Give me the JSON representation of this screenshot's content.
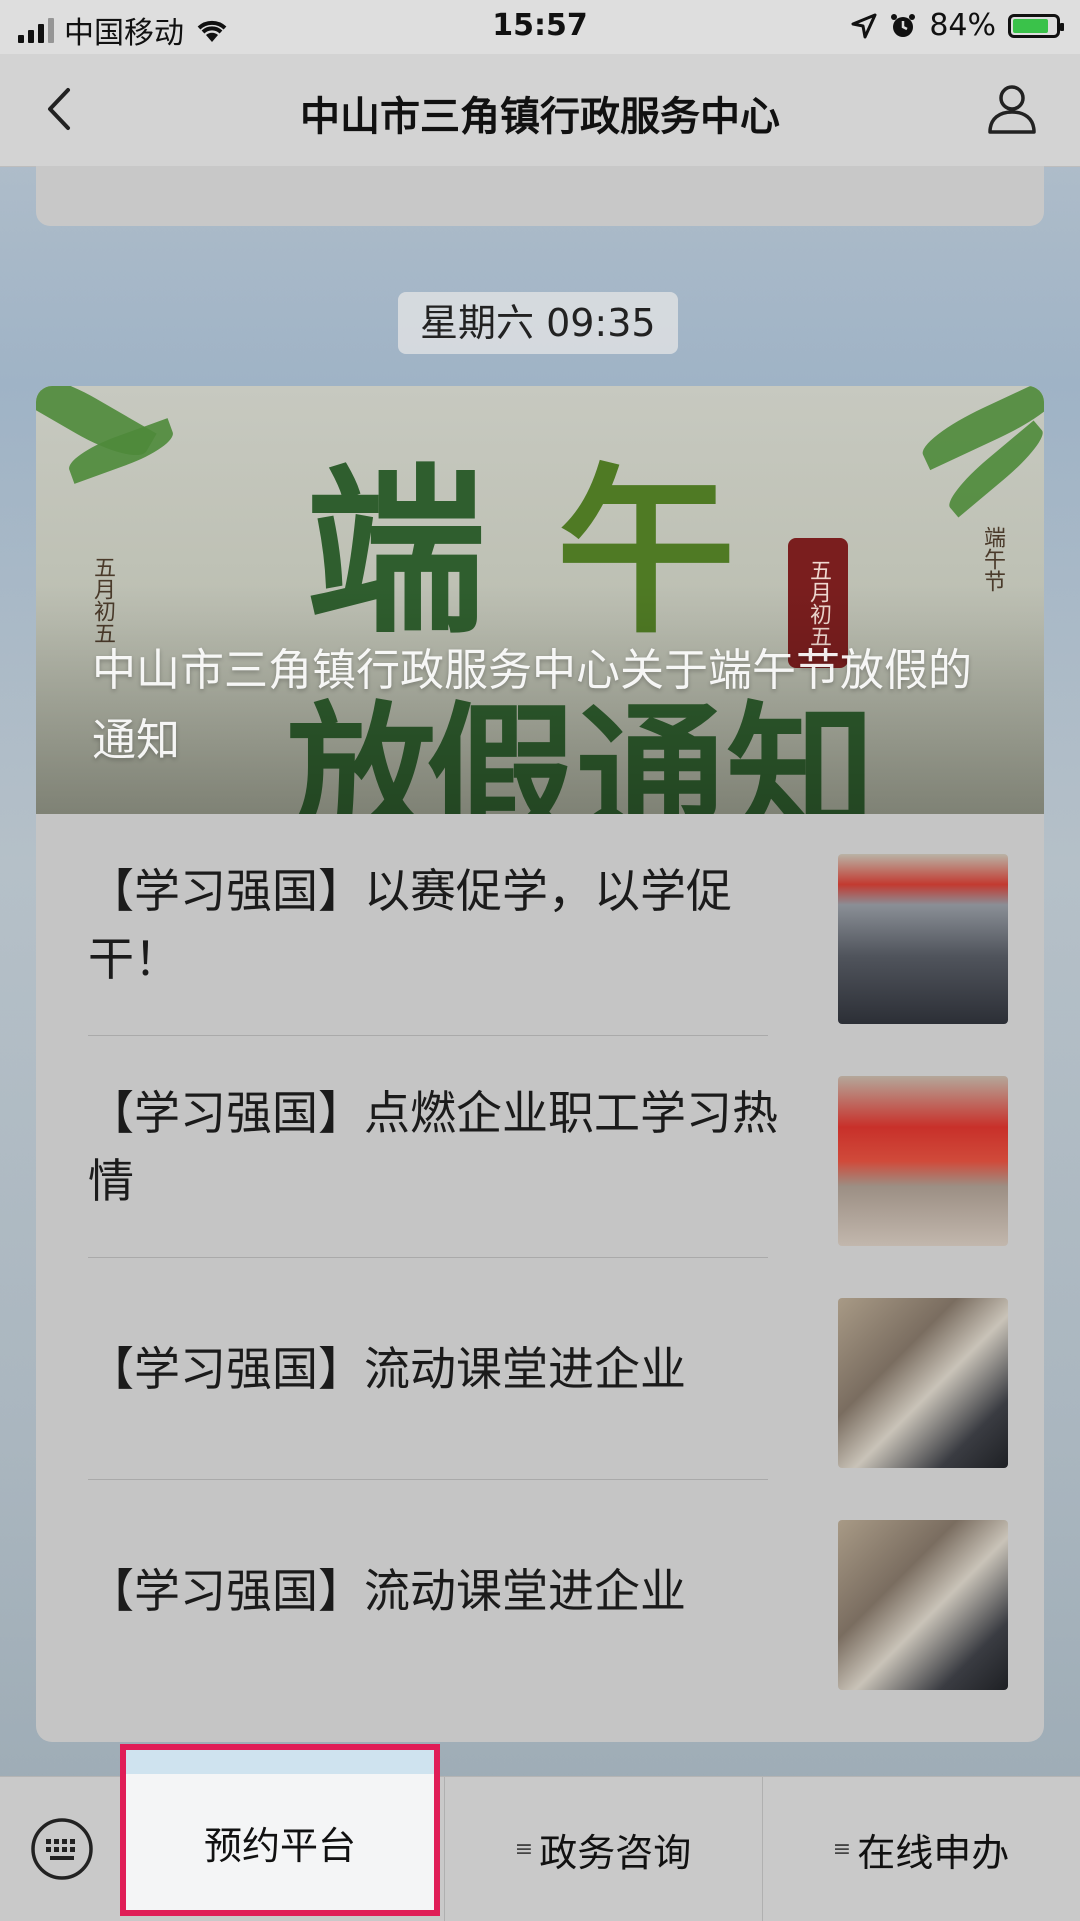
{
  "status_bar": {
    "carrier": "中国移动",
    "time": "15:57",
    "battery_pct_text": "84%",
    "battery_level": 0.84
  },
  "nav": {
    "title": "中山市三角镇行政服务中心"
  },
  "message": {
    "timestamp": "星期六 09:35",
    "hero": {
      "title": "中山市三角镇行政服务中心关于端午节放假的通知",
      "image_chars": [
        "端",
        "午",
        "放",
        "假",
        "通",
        "知"
      ],
      "seal_text": "五月初五",
      "side_left": "五月初五",
      "side_right": "端午节"
    },
    "items": [
      {
        "title": "【学习强国】以赛促学，以学促干！"
      },
      {
        "title": "【学习强国】点燃企业职工学习热情"
      },
      {
        "title": "【学习强国】流动课堂进企业"
      },
      {
        "title": "【学习强国】流动课堂进企业"
      }
    ]
  },
  "bottom_menu": {
    "items": [
      {
        "label": "预约平台"
      },
      {
        "label": "政务咨询"
      },
      {
        "label": "在线申办"
      }
    ]
  },
  "colors": {
    "highlight": "#e01d57",
    "battery": "#3ac24a"
  }
}
